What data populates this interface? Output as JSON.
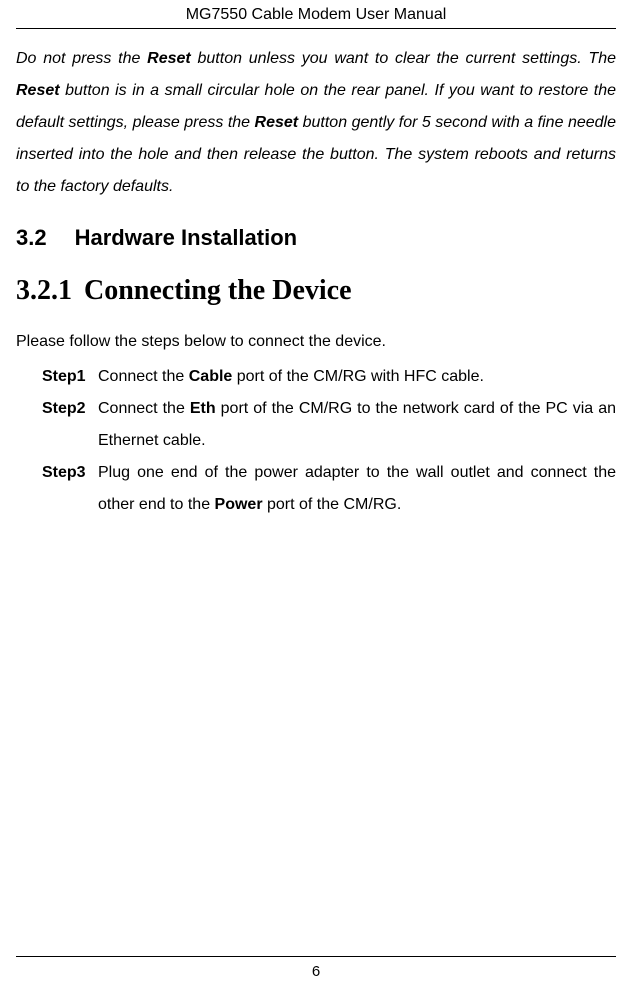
{
  "header": {
    "title": "MG7550 Cable Modem User Manual"
  },
  "intro": {
    "p1": "Do not press the ",
    "p2": "Reset",
    "p3": " button unless you want to clear the current settings. The ",
    "p4": "Reset",
    "p5": " button is in a small circular hole on the rear panel. If you want to restore the default settings, please press the ",
    "p6": "Reset",
    "p7": " button gently for 5 second with a fine needle inserted into the hole and then release the button. The system reboots and returns to the factory defaults."
  },
  "section": {
    "number": "3.2",
    "title": "Hardware Installation"
  },
  "subsection": {
    "number": "3.2.1",
    "title": "Connecting the Device"
  },
  "body": {
    "lead": "Please follow the steps below to connect the device."
  },
  "steps": [
    {
      "label": "Step1",
      "t1": "Connect the ",
      "b1": "Cable",
      "t2": " port of the CM/RG with HFC cable."
    },
    {
      "label": "Step2",
      "t1": "Connect the ",
      "b1": "Eth",
      "t2": " port of the CM/RG to the network card of the PC via an Ethernet cable."
    },
    {
      "label": "Step3",
      "t1": "Plug one end of the power adapter to the wall outlet and connect the other end to the ",
      "b1": "Power",
      "t2": " port of the CM/RG."
    }
  ],
  "footer": {
    "page": "6"
  }
}
